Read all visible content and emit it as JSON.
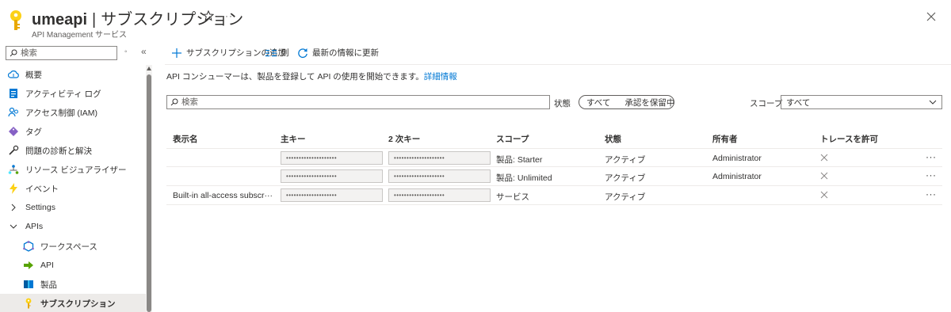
{
  "header": {
    "resource_name": "umeapi",
    "separator": "|",
    "page_title": "サブスクリプション",
    "subtitle": "API Management サービス",
    "star_icon": "star-outline-icon",
    "more": "···",
    "close_icon": "close-icon"
  },
  "sidebar": {
    "search_placeholder": "検索",
    "items": [
      {
        "label": "概要",
        "icon": "cloud-overview-icon",
        "indent": 0
      },
      {
        "label": "アクティビティ ログ",
        "icon": "activity-log-icon",
        "indent": 0
      },
      {
        "label": "アクセス制御 (IAM)",
        "icon": "iam-users-icon",
        "indent": 0
      },
      {
        "label": "タグ",
        "icon": "tag-icon",
        "indent": 0
      },
      {
        "label": "問題の診断と解決",
        "icon": "wrench-icon",
        "indent": 0
      },
      {
        "label": "リソース ビジュアライザー",
        "icon": "visualizer-icon",
        "indent": 0
      },
      {
        "label": "イベント",
        "icon": "lightning-icon",
        "indent": 0
      },
      {
        "label": "Settings",
        "icon": "chevron-right-icon",
        "indent": 0
      },
      {
        "label": "APIs",
        "icon": "chevron-down-icon",
        "indent": 0
      },
      {
        "label": "ワークスペース",
        "icon": "workspace-icon",
        "indent": 1
      },
      {
        "label": "API",
        "icon": "api-arrow-icon",
        "indent": 1
      },
      {
        "label": "製品",
        "icon": "product-icon",
        "indent": 1
      },
      {
        "label": "サブスクリプション",
        "icon": "key-icon",
        "indent": 1,
        "selected": true
      }
    ]
  },
  "toolbar": {
    "add_label": "サブスクリプションの追加",
    "columns_label": "列",
    "refresh_label": "最新の情報に更新"
  },
  "description": {
    "text": "API コンシューマーは、製品を登録して API の使用を開始できます。",
    "link": "詳細情報"
  },
  "filters": {
    "search_placeholder": "検索",
    "state_label": "状態",
    "state_options": [
      "すべて",
      "承認を保留中"
    ],
    "scope_label": "スコープ",
    "scope_value": "すべて"
  },
  "table": {
    "columns": [
      "表示名",
      "主キー",
      "2 次キー",
      "スコープ",
      "状態",
      "所有者",
      "トレースを許可"
    ],
    "rows": [
      {
        "display_name": "",
        "primary_key": "••••••••••••••••••••",
        "secondary_key": "••••••••••••••••••••",
        "scope": "製品: Starter",
        "state": "アクティブ",
        "owner": "Administrator",
        "trace_icon": "x-mark-icon",
        "more": "···"
      },
      {
        "display_name": "",
        "primary_key": "••••••••••••••••••••",
        "secondary_key": "••••••••••••••••••••",
        "scope": "製品: Unlimited",
        "state": "アクティブ",
        "owner": "Administrator",
        "trace_icon": "x-mark-icon",
        "more": "···"
      },
      {
        "display_name": "Built-in all-access subscr···",
        "primary_key": "••••••••••••••••••••",
        "secondary_key": "••••••••••••••••••••",
        "scope": "サービス",
        "state": "アクティブ",
        "owner": "",
        "trace_icon": "x-mark-icon",
        "more": "···"
      }
    ]
  },
  "colors": {
    "accent": "#0078d4",
    "key_gold": "#fcd116",
    "border": "#8a8886",
    "selected_bg": "#edebe9"
  }
}
